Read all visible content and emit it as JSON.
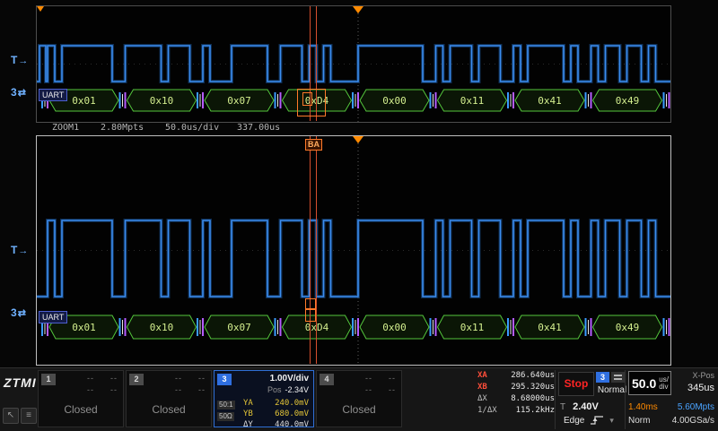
{
  "colors": {
    "trace_blue": "#3b8df0",
    "decode_green": "#54c73c",
    "cursor_orange": "#d64e2e",
    "trigger_orange": "#ff8a00",
    "stop_red": "#ff2424",
    "cursor_yellow": "#e2c437"
  },
  "icons": {
    "arrow_right": "→",
    "channel_glyph": "⇄",
    "chevron_down": "▾",
    "pointer": "↖",
    "menu": "≡"
  },
  "decode": {
    "bus_label": "UART",
    "bytes": [
      "0x01",
      "0x10",
      "0x07",
      "0xD4",
      "0x00",
      "0x11",
      "0x41",
      "0x49"
    ]
  },
  "markers": {
    "trigger": "T",
    "channel": "3",
    "cursor_pair": "BA"
  },
  "zoom_window": {
    "status": {
      "name": "ZOOM1",
      "points": "2.80Mpts",
      "scale": "50.0us/div",
      "offset": "337.00us"
    }
  },
  "bottom_bar": {
    "logo": "ZTMI",
    "channels": [
      {
        "id": "1",
        "state": "Closed",
        "dash": "--"
      },
      {
        "id": "2",
        "state": "Closed",
        "dash": "--"
      },
      {
        "id": "3",
        "scale": "1.00V/div",
        "pos_label": "Pos",
        "pos": "-2.34V",
        "probe": "50:1",
        "impedance": "50Ω",
        "ya_label": "YA",
        "ya": "240.0mV",
        "yb_label": "YB",
        "yb": "680.0mV",
        "dy_label": "ΔY",
        "dy": "440.0mV"
      },
      {
        "id": "4",
        "state": "Closed",
        "dash": "--"
      }
    ],
    "cursor_x": {
      "xa_label": "XA",
      "xa": "286.640us",
      "xb_label": "XB",
      "xb": "295.320us",
      "dx_label": "ΔX",
      "dx": "8.68000us",
      "inv_label": "1/ΔX",
      "inv": "115.2kHz"
    },
    "acquisition": {
      "status": "Stop",
      "mode": "Normal",
      "source": "3"
    },
    "trigger": {
      "t_label": "T",
      "level": "2.40V",
      "type": "Edge"
    },
    "timebase": {
      "scale": "50.0",
      "unit_line1": "us/",
      "unit_line2": "div",
      "xpos_label": "X-Pos",
      "xpos": "345us",
      "window": "1.40ms",
      "points": "5.60Mpts",
      "acq_mode": "Norm",
      "sample_rate": "4.00GSa/s"
    }
  }
}
